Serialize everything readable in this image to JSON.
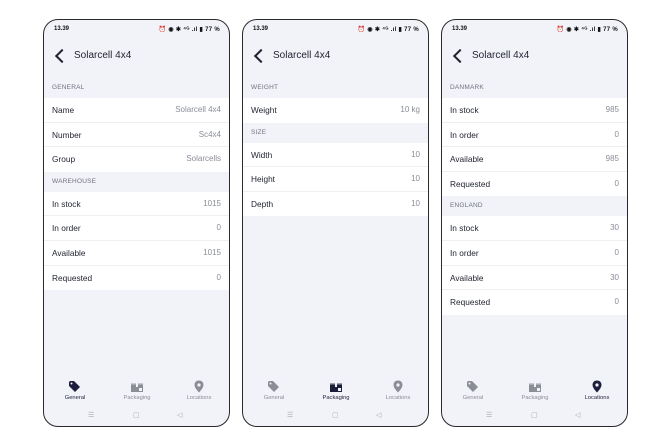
{
  "screens": [
    {
      "status": {
        "time": "13.39",
        "icons": "⏰ ◉ ✱ ⁴ᴳ .ıl ▮ 77 %"
      },
      "header": {
        "title": "Solarcell 4x4"
      },
      "sections": [
        {
          "label": "GENERAL",
          "rows": [
            {
              "label": "Name",
              "value": "Solarcell 4x4"
            },
            {
              "label": "Number",
              "value": "Sc4x4"
            },
            {
              "label": "Group",
              "value": "Solarcells"
            }
          ]
        },
        {
          "label": "WAREHOUSE",
          "rows": [
            {
              "label": "In stock",
              "value": "1015"
            },
            {
              "label": "In order",
              "value": "0"
            },
            {
              "label": "Available",
              "value": "1015"
            },
            {
              "label": "Requested",
              "value": "0"
            }
          ]
        }
      ],
      "active_tab": "General"
    },
    {
      "status": {
        "time": "13.39",
        "icons": "⏰ ◉ ✱ ⁴ᴳ .ıl ▮ 77 %"
      },
      "header": {
        "title": "Solarcell 4x4"
      },
      "sections": [
        {
          "label": "WEIGHT",
          "rows": [
            {
              "label": "Weight",
              "value": "10 kg"
            }
          ]
        },
        {
          "label": "SIZE",
          "rows": [
            {
              "label": "Width",
              "value": "10"
            },
            {
              "label": "Height",
              "value": "10"
            },
            {
              "label": "Depth",
              "value": "10"
            }
          ]
        }
      ],
      "active_tab": "Packaging"
    },
    {
      "status": {
        "time": "13.39",
        "icons": "⏰ ◉ ✱ ⁴ᴳ .ıl ▮ 77 %"
      },
      "header": {
        "title": "Solarcell 4x4"
      },
      "sections": [
        {
          "label": "DANMARK",
          "rows": [
            {
              "label": "In stock",
              "value": "985"
            },
            {
              "label": "In order",
              "value": "0"
            },
            {
              "label": "Available",
              "value": "985"
            },
            {
              "label": "Requested",
              "value": "0"
            }
          ]
        },
        {
          "label": "ENGLAND",
          "rows": [
            {
              "label": "In stock",
              "value": "30"
            },
            {
              "label": "In order",
              "value": "0"
            },
            {
              "label": "Available",
              "value": "30"
            },
            {
              "label": "Requested",
              "value": "0"
            }
          ]
        }
      ],
      "active_tab": "Locations"
    }
  ],
  "tabs": [
    {
      "label": "General",
      "icon": "tag-icon"
    },
    {
      "label": "Packaging",
      "icon": "package-icon"
    },
    {
      "label": "Locations",
      "icon": "map-pin-icon"
    }
  ],
  "system_nav": {
    "recents": "☰",
    "home": "▢",
    "back": "◁"
  },
  "colors": {
    "active_icon": "#1c1e3c",
    "inactive_icon": "#8b8d97",
    "background": "#f2f3f8",
    "row": "#ffffff"
  }
}
